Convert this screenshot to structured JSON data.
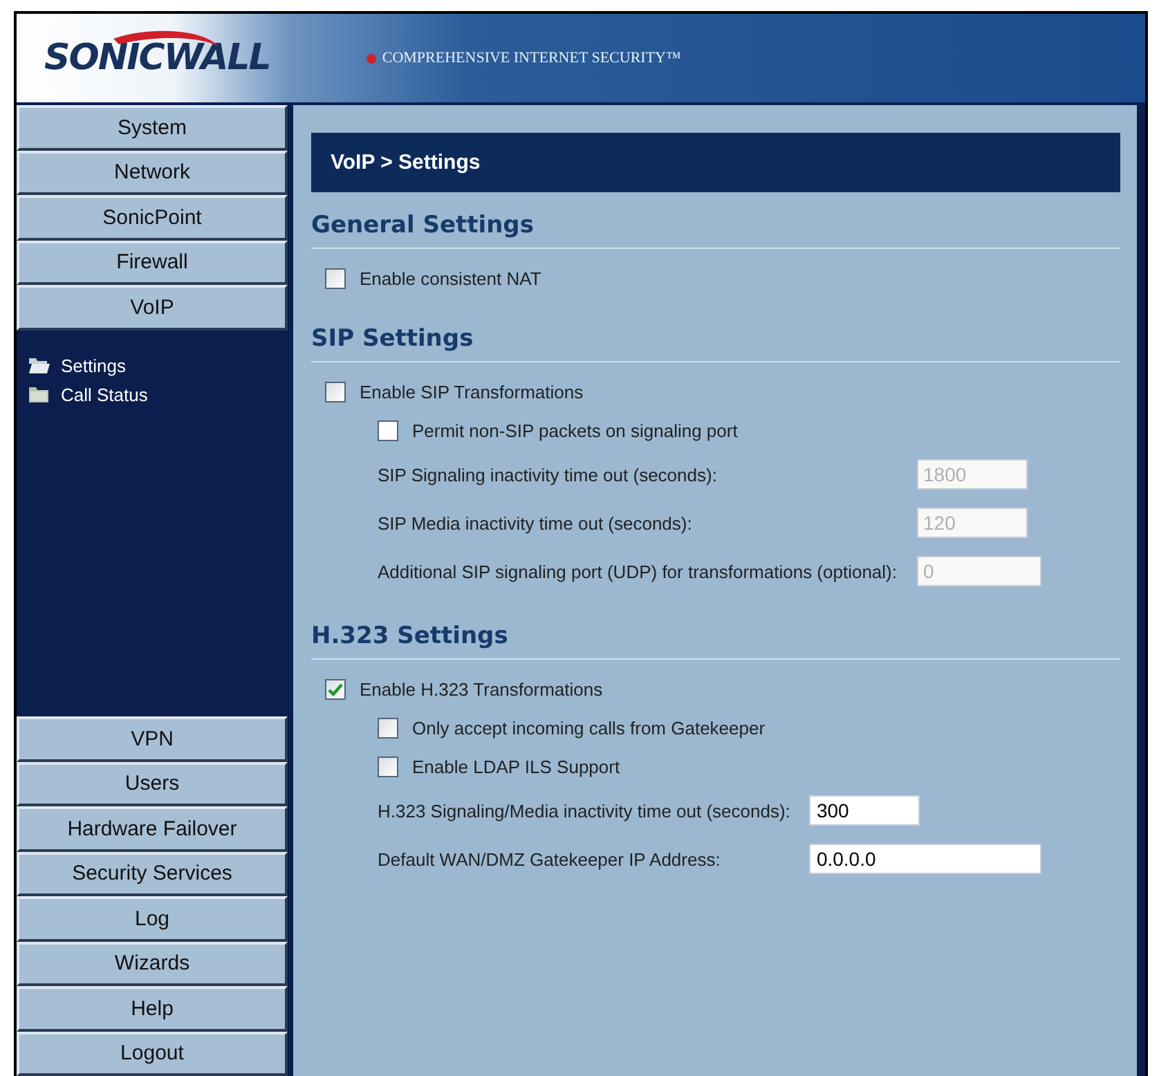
{
  "header": {
    "logo": "SONICWALL",
    "tagline": "COMPREHENSIVE INTERNET SECURITY™"
  },
  "sidebar": {
    "top_buttons": [
      {
        "label": "System"
      },
      {
        "label": "Network"
      },
      {
        "label": "SonicPoint"
      },
      {
        "label": "Firewall"
      },
      {
        "label": "VoIP"
      }
    ],
    "items": [
      {
        "label": "Settings",
        "selected": true
      },
      {
        "label": "Call Status",
        "selected": false
      }
    ],
    "bottom_buttons": [
      {
        "label": "VPN"
      },
      {
        "label": "Users"
      },
      {
        "label": "Hardware Failover"
      },
      {
        "label": "Security Services"
      },
      {
        "label": "Log"
      },
      {
        "label": "Wizards"
      },
      {
        "label": "Help"
      },
      {
        "label": "Logout"
      }
    ]
  },
  "page_title": "VoIP > Settings",
  "sections": [
    {
      "heading": "General Settings",
      "rows": [
        {
          "kind": "checkbox",
          "label": "Enable consistent NAT",
          "checked": false
        }
      ]
    },
    {
      "heading": "SIP Settings",
      "rows": [
        {
          "kind": "checkbox",
          "label": "Enable SIP Transformations",
          "checked": false,
          "children": [
            {
              "kind": "checkbox",
              "label": "Permit non-SIP packets on signaling port",
              "checked": false,
              "disabled": true
            },
            {
              "kind": "field",
              "label": "SIP Signaling inactivity time out (seconds):",
              "value": "1800",
              "disabled": true
            },
            {
              "kind": "field",
              "label": "SIP Media inactivity time out (seconds):",
              "value": "120",
              "disabled": true
            },
            {
              "kind": "field",
              "label": "Additional SIP signaling port (UDP) for transformations (optional):",
              "value": "0",
              "disabled": true
            }
          ]
        }
      ]
    },
    {
      "heading": "H.323 Settings",
      "rows": [
        {
          "kind": "checkbox",
          "label": "Enable H.323 Transformations",
          "checked": true,
          "children": [
            {
              "kind": "checkbox",
              "label": "Only accept incoming calls from Gatekeeper",
              "checked": false,
              "disabled": false
            },
            {
              "kind": "checkbox",
              "label": "Enable LDAP ILS Support",
              "checked": false,
              "disabled": false
            },
            {
              "kind": "field",
              "label": "H.323 Signaling/Media inactivity time out (seconds):",
              "value": "300",
              "disabled": false
            },
            {
              "kind": "field",
              "label": "Default WAN/DMZ Gatekeeper IP Address:",
              "value": "0.0.0.0",
              "disabled": false,
              "wide": true
            }
          ]
        }
      ]
    }
  ]
}
